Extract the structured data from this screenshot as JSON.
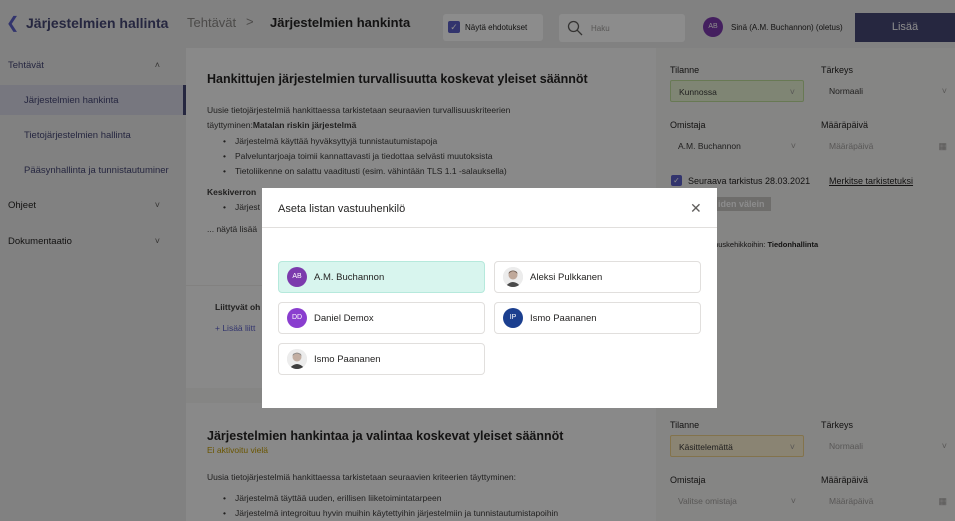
{
  "topbar": {
    "app_title": "Järjestelmien hallinta",
    "breadcrumb_1": "Tehtävät",
    "breadcrumb_sep": ">",
    "breadcrumb_2": "Järjestelmien hankinta",
    "suggestions_label": "Näytä ehdotukset",
    "suggestions_checked": true,
    "search_placeholder": "Haku",
    "user_initials": "AB",
    "user_name": "Sinä (A.M. Buchannon) (oletus)",
    "add_label": "Lisää"
  },
  "sidebar": {
    "items": [
      {
        "label": "Tehtävät",
        "chevron": "^"
      },
      {
        "label": "Järjestelmien hankinta"
      },
      {
        "label": "Tietojärjestelmien hallinta"
      },
      {
        "label": "Pääsynhallinta ja tunnistautuminer"
      },
      {
        "label": "Ohjeet",
        "chevron": "v"
      },
      {
        "label": "Dokumentaatio",
        "chevron": "v"
      }
    ]
  },
  "card1": {
    "title": "Hankittujen järjestelmien turvallisuutta koskevat yleiset säännöt",
    "intro_1": "Uusie tietojärjestelmiä hankittaessa tarkistetaan seuraavien turvallisuuskriteerien",
    "intro_2a": "täyttyminen:",
    "intro_2b": "Matalan riskin järjestelmä",
    "bullets": [
      "Järjestelmä käyttää hyväksyttyjä tunnistautumistapoja",
      "Palveluntarjoaja toimii kannattavasti ja tiedottaa selvästi muutoksista",
      "Tietoliikenne on salattu vaaditusti (esim. vähintään TLS 1.1 -salauksella)"
    ],
    "sub_heading": "Keskiverron",
    "sub_bullet": "Järjest",
    "show_more": "... näytä lisää",
    "related_label": "Liittyvät oh",
    "add_related": "+ Lisää liitt"
  },
  "panel1": {
    "status_label": "Tilanne",
    "status_value": "Kunnossa",
    "priority_label": "Tärkeys",
    "priority_value": "Normaali",
    "owner_label": "Omistaja",
    "owner_value": "A.M. Buchannon",
    "due_label": "Määräpäivä",
    "due_placeholder": "Määräpäivä",
    "next_review": "Seuraava tarkistus 28.03.2021",
    "mark_reviewed": "Merkitse tarkistetuksi",
    "interval_btn": "iden välein",
    "framework_prefix": "muskehikkoihin: ",
    "framework_name": "Tiedonhallinta"
  },
  "card2": {
    "title": "Järjestelmien hankintaa ja valintaa koskevat yleiset säännöt",
    "status_note": "Ei aktivoitu vielä",
    "intro": "Uusia tietojärjestelmiä hankittaessa tarkistetaan seuraavien kriteerien täyttyminen:",
    "bullets": [
      "Järjestelmä täyttää uuden, erillisen liiketoimintatarpeen",
      "Järjestelmä integroituu hyvin muihin käytettyihin järjestelmiin ja tunnistautumistapoihin"
    ]
  },
  "panel2": {
    "status_label": "Tilanne",
    "status_value": "Käsittelemättä",
    "priority_label": "Tärkeys",
    "priority_value": "Normaali",
    "owner_label": "Omistaja",
    "owner_placeholder": "Valitse omistaja",
    "due_label": "Määräpäivä",
    "due_placeholder": "Määräpäivä"
  },
  "modal": {
    "title": "Aseta listan vastuuhenkilö",
    "people": [
      {
        "name": "A.M. Buchannon",
        "initials": "AB",
        "avatar_color": "#7c3aad",
        "selected": true
      },
      {
        "name": "Aleksi Pulkkanen",
        "photo": true
      },
      {
        "name": "Daniel Demox",
        "initials": "DD",
        "avatar_color": "#8a3ecf"
      },
      {
        "name": "Ismo Paananen",
        "initials": "IP",
        "avatar_color": "#1b3f8f"
      },
      {
        "name": "Ismo Paananen",
        "photo": true
      }
    ]
  },
  "colors": {
    "accent": "#464775",
    "brand_purple": "#5b5fc7",
    "selected_person_bg": "#d8f5ee"
  }
}
